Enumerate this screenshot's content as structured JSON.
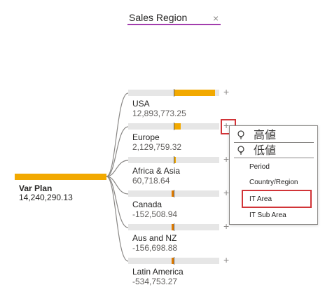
{
  "header": {
    "title": "Sales Region",
    "close_glyph": "×"
  },
  "root": {
    "label": "Var Plan",
    "value": "14,240,290.13"
  },
  "nodes": [
    {
      "label": "USA",
      "value": "12,893,773.25",
      "share": 0.9054
    },
    {
      "label": "Europe",
      "value": "2,129,759.32",
      "share": 0.1496
    },
    {
      "label": "Africa & Asia",
      "value": "60,718.64",
      "share": 0.0043
    },
    {
      "label": "Canada",
      "value": "-152,508.94",
      "share": -0.0107
    },
    {
      "label": "Aus and NZ",
      "value": "-156,698.88",
      "share": -0.011
    },
    {
      "label": "Latin America",
      "value": "-534,753.27",
      "share": -0.0376
    }
  ],
  "expander_glyph": "+",
  "menu": {
    "high_value": "高値",
    "low_value": "低値",
    "items": [
      "Period",
      "Country/Region",
      "IT Area",
      "IT Sub Area"
    ]
  },
  "colors": {
    "positive": "#f2a900",
    "negative": "#e07b00",
    "accent_underline": "#a23dad",
    "highlight": "#d13438"
  }
}
